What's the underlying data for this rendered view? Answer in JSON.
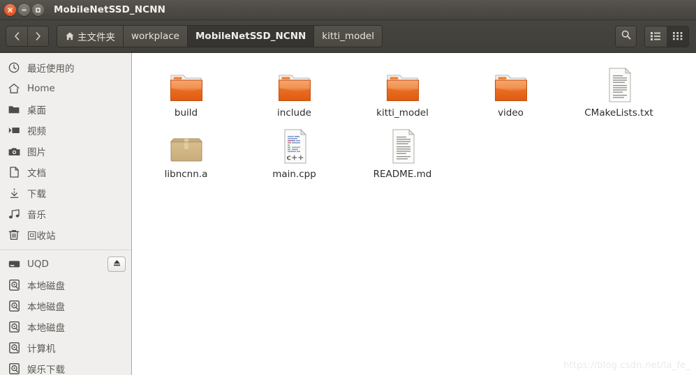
{
  "window": {
    "title": "MobileNetSSD_NCNN",
    "buttons": {
      "close": "close-button",
      "minimize": "minimize-button",
      "maximize": "maximize-button"
    }
  },
  "toolbar": {
    "back_label": "Back",
    "forward_label": "Forward",
    "breadcrumbs": [
      {
        "label": "主文件夹",
        "icon": "home-icon",
        "state": "raised"
      },
      {
        "label": "workplace",
        "icon": "",
        "state": "raised"
      },
      {
        "label": "MobileNetSSD_NCNN",
        "icon": "",
        "state": "active"
      },
      {
        "label": "kitti_model",
        "icon": "",
        "state": "raised"
      }
    ],
    "search_label": "Search",
    "view_list_label": "List view",
    "view_icon_label": "Icon view"
  },
  "sidebar": {
    "groups": [
      {
        "items": [
          {
            "label": "最近使用的",
            "icon": "clock-icon"
          },
          {
            "label": "Home",
            "icon": "home-icon"
          },
          {
            "label": "桌面",
            "icon": "folder-icon"
          },
          {
            "label": "视频",
            "icon": "video-icon"
          },
          {
            "label": "图片",
            "icon": "camera-icon"
          },
          {
            "label": "文档",
            "icon": "document-icon"
          },
          {
            "label": "下载",
            "icon": "download-icon"
          },
          {
            "label": "音乐",
            "icon": "music-icon"
          },
          {
            "label": "回收站",
            "icon": "trash-icon"
          }
        ]
      },
      {
        "items": [
          {
            "label": "UQD",
            "icon": "drive-icon",
            "eject": true
          },
          {
            "label": "本地磁盘",
            "icon": "disk-icon"
          },
          {
            "label": "本地磁盘",
            "icon": "disk-icon"
          },
          {
            "label": "本地磁盘",
            "icon": "disk-icon"
          },
          {
            "label": "计算机",
            "icon": "disk-icon"
          },
          {
            "label": "娱乐下载",
            "icon": "disk-icon"
          }
        ]
      }
    ]
  },
  "files": {
    "rows": [
      [
        {
          "name": "build",
          "type": "folder"
        },
        {
          "name": "include",
          "type": "folder"
        },
        {
          "name": "kitti_model",
          "type": "folder"
        },
        {
          "name": "video",
          "type": "folder"
        },
        {
          "name": "CMakeLists.txt",
          "type": "text"
        }
      ],
      [
        {
          "name": "libncnn.a",
          "type": "package"
        },
        {
          "name": "main.cpp",
          "type": "cpp"
        },
        {
          "name": "README.md",
          "type": "text"
        }
      ]
    ]
  },
  "watermark": {
    "text": "https://blog.csdn.net/la_fe_"
  },
  "colors": {
    "titlebar": "#4e4b46",
    "toolbar": "#443f3a",
    "sidebar_bg": "#f0efed",
    "folder_orange": "#e8641f",
    "accent_close": "#e2562a"
  }
}
